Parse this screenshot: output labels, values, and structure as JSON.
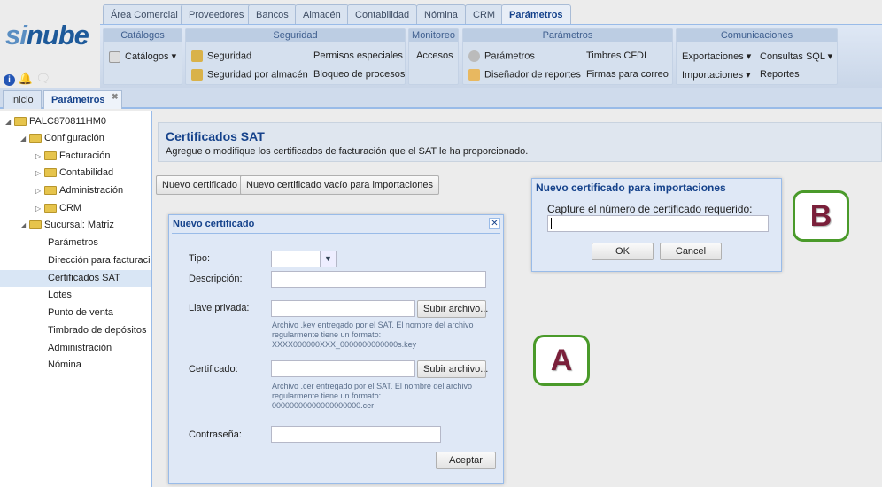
{
  "logo": {
    "text_a": "si",
    "text_b": "nube"
  },
  "top_tabs": [
    "Área Comercial",
    "Proveedores",
    "Bancos",
    "Almacén",
    "Contabilidad",
    "Nómina",
    "CRM",
    "Parámetros"
  ],
  "ribbon": {
    "catalogos": {
      "title": "Catálogos",
      "items": [
        "Catálogos"
      ]
    },
    "seguridad": {
      "title": "Seguridad",
      "items": [
        "Seguridad",
        "Seguridad por almacén",
        "Permisos especiales",
        "Bloqueo de procesos"
      ]
    },
    "monitoreo": {
      "title": "Monitoreo",
      "items": [
        "Accesos"
      ]
    },
    "parametros": {
      "title": "Parámetros",
      "items": [
        "Parámetros",
        "Diseñador de reportes",
        "Timbres CFDI",
        "Firmas para correo"
      ]
    },
    "comunicaciones": {
      "title": "Comunicaciones",
      "items": [
        "Exportaciones",
        "Importaciones",
        "Consultas SQL",
        "Reportes"
      ]
    }
  },
  "doc_tabs": [
    "Inicio",
    "Parámetros"
  ],
  "tree": [
    "PALC870811HM0",
    "Configuración",
    "Facturación",
    "Contabilidad",
    "Administración",
    "CRM",
    "Sucursal: Matriz",
    "Parámetros",
    "Dirección para facturación",
    "Certificados SAT",
    "Lotes",
    "Punto de venta",
    "Timbrado de depósitos",
    "Administración",
    "Nómina"
  ],
  "header": {
    "title": "Certificados SAT",
    "subtitle": "Agregue o modifique los certificados de facturación que el SAT le ha proporcionado."
  },
  "buttons": {
    "new": "Nuevo certificado",
    "new_empty": "Nuevo certificado vacío para importaciones"
  },
  "dialog_new": {
    "title": "Nuevo certificado",
    "tipo": "Tipo:",
    "descripcion": "Descripción:",
    "llave": "Llave privada:",
    "certificado": "Certificado:",
    "contrasena": "Contraseña:",
    "upload": "Subir archivo...",
    "hint_key_1": "Archivo .key entregado por el SAT. El nombre del archivo",
    "hint_key_2": "regularmente tiene un formato:",
    "hint_key_3": "XXXX000000XXX_0000000000000s.key",
    "hint_cer_1": "Archivo .cer entregado por el SAT. El nombre del archivo",
    "hint_cer_2": "regularmente tiene un formato:",
    "hint_cer_3": "00000000000000000000.cer",
    "accept": "Aceptar"
  },
  "dialog_import": {
    "title": "Nuevo certificado para importaciones",
    "prompt": "Capture el número de certificado requerido:",
    "ok": "OK",
    "cancel": "Cancel"
  },
  "callouts": {
    "a": "A",
    "b": "B"
  }
}
